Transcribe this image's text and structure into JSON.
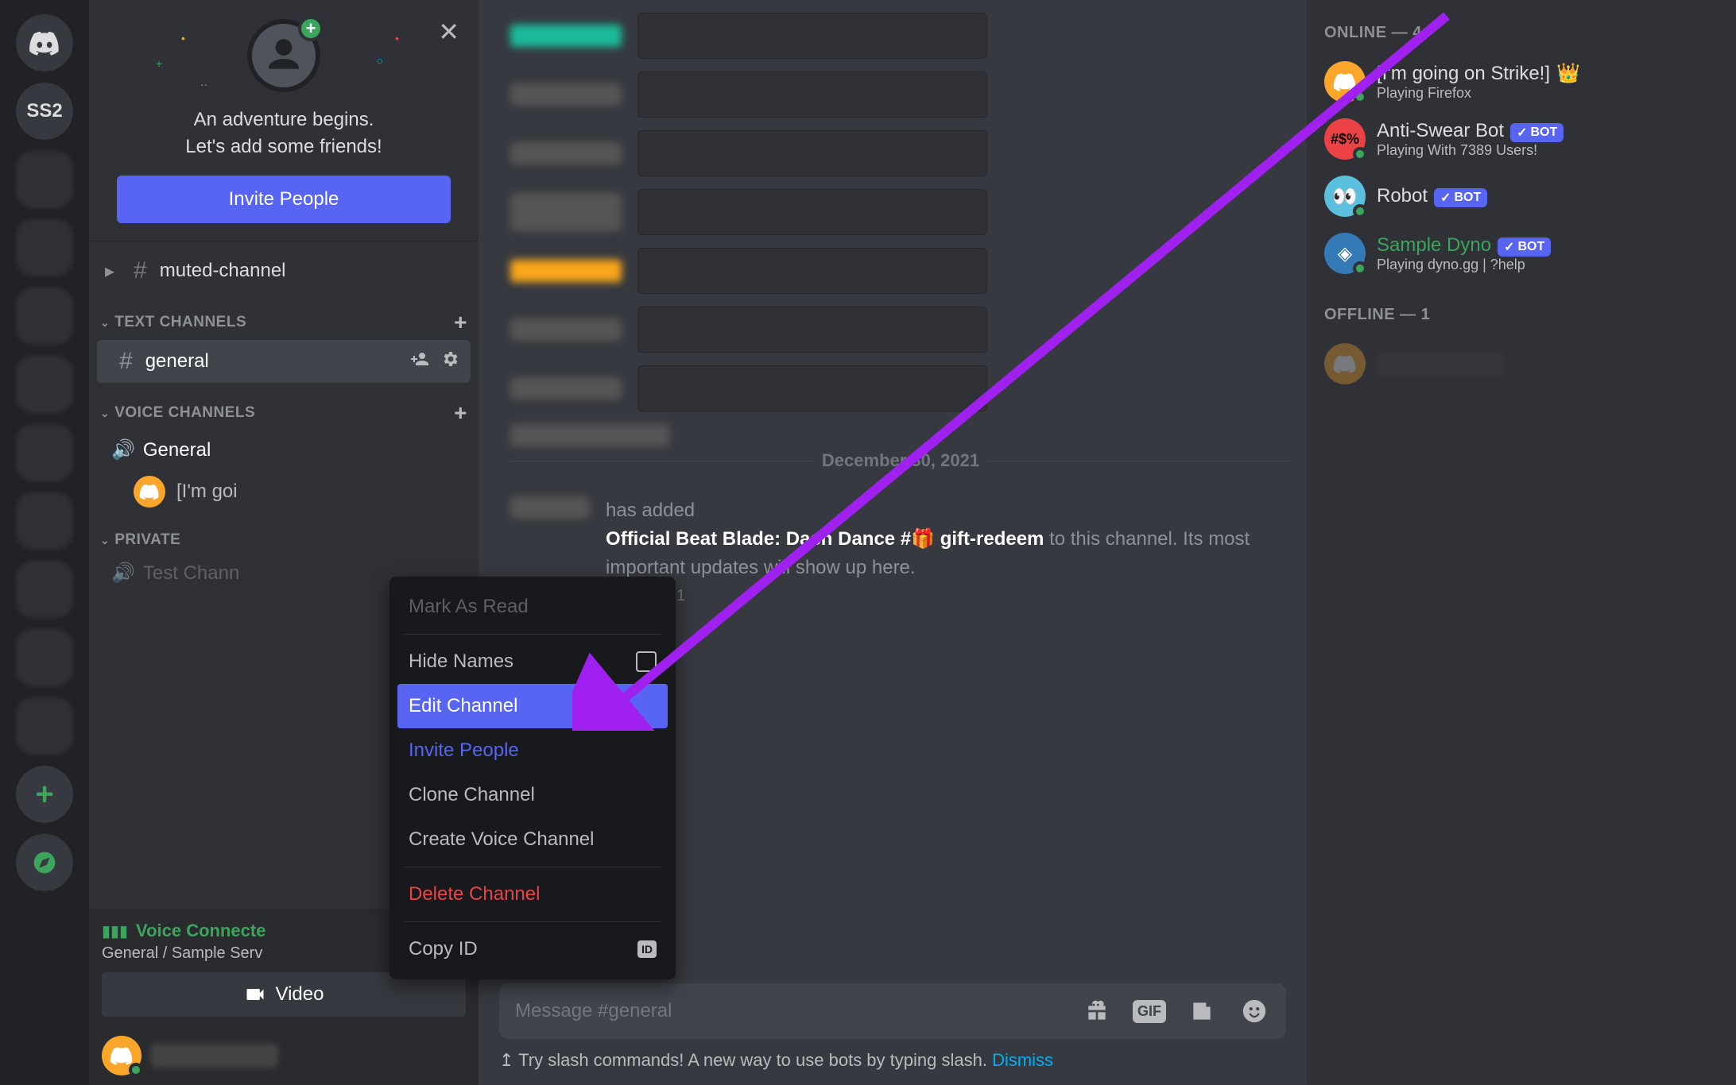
{
  "servers": {
    "text_server": "SS2"
  },
  "invite": {
    "line1": "An adventure begins.",
    "line2": "Let's add some friends!",
    "button": "Invite People"
  },
  "channels": {
    "muted": "muted-channel",
    "text_header": "TEXT CHANNELS",
    "general": "general",
    "voice_header": "VOICE CHANNELS",
    "voice_general": "General",
    "voice_user": "[I'm goi",
    "private_header": "PRIVATE",
    "test_channel": "Test Chann"
  },
  "voice_panel": {
    "status": "Voice Connecte",
    "sub": "General / Sample Serv",
    "video": "Video"
  },
  "context_menu": {
    "mark_read": "Mark As Read",
    "hide_names": "Hide Names",
    "edit_channel": "Edit Channel",
    "invite_people": "Invite People",
    "clone_channel": "Clone Channel",
    "create_voice": "Create Voice Channel",
    "delete_channel": "Delete Channel",
    "copy_id": "Copy ID",
    "id_badge": "ID"
  },
  "chat": {
    "date_divider": "December 30, 2021",
    "sys_has_added": "has added",
    "sys_channel_name": "Official Beat Blade: Dash Dance #🎁 gift-redeem",
    "sys_tail": " to this channel. Its most important updates will show up here.",
    "sys_date": "12/30/2021",
    "placeholder": "Message #general",
    "gif": "GIF",
    "slash_hint_pre": "↥ Try slash commands! A new way to use bots by typing slash. ",
    "slash_dismiss": "Dismiss"
  },
  "members": {
    "online_header": "ONLINE — 4",
    "offline_header": "OFFLINE — 1",
    "m1_name": "[I'm going on Strike!]",
    "m1_sub": "Playing Firefox",
    "m2_name": "Anti-Swear Bot",
    "m2_sub": "Playing With 7389 Users!",
    "m3_name": "Robot",
    "m4_name": "Sample Dyno",
    "m4_sub": "Playing dyno.gg | ?help",
    "bot": "BOT"
  }
}
